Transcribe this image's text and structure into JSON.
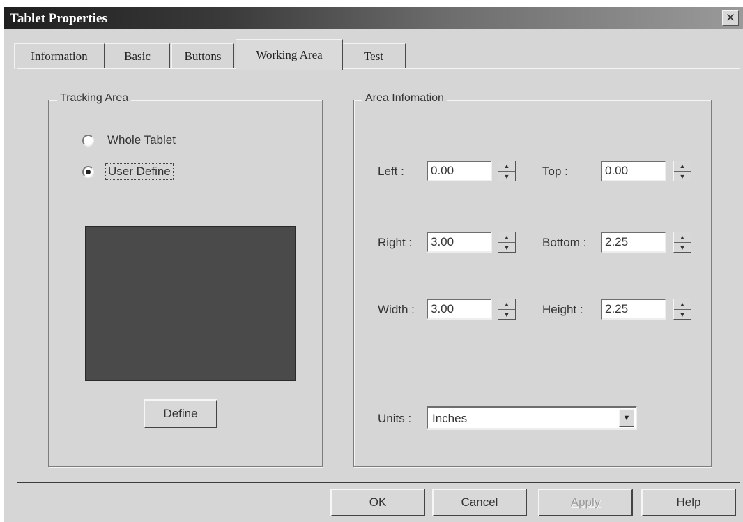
{
  "window": {
    "title": "Tablet Properties",
    "close_glyph": "✕"
  },
  "tabs": [
    {
      "label": "Information"
    },
    {
      "label": "Basic"
    },
    {
      "label": "Buttons"
    },
    {
      "label": "Working Area",
      "active": true
    },
    {
      "label": "Test"
    }
  ],
  "tracking_area": {
    "title": "Tracking Area",
    "options": [
      {
        "label": "Whole Tablet",
        "checked": false
      },
      {
        "label": "User Define",
        "checked": true
      }
    ],
    "define_label": "Define"
  },
  "area_info": {
    "title": "Area Infomation",
    "left": {
      "label": "Left :",
      "value": "0.00"
    },
    "top": {
      "label": "Top :",
      "value": "0.00"
    },
    "right": {
      "label": "Right :",
      "value": "3.00"
    },
    "bottom": {
      "label": "Bottom :",
      "value": "2.25"
    },
    "width": {
      "label": "Width :",
      "value": "3.00"
    },
    "height": {
      "label": "Height :",
      "value": "2.25"
    },
    "units": {
      "label": "Units :",
      "value": "Inches"
    }
  },
  "footer": {
    "ok": "OK",
    "cancel": "Cancel",
    "apply": "Apply",
    "help": "Help"
  },
  "colors": {
    "dialog_bg": "#d6d6d6",
    "title_dark": "#1f1f1f",
    "preview": "#4a4a4a"
  }
}
